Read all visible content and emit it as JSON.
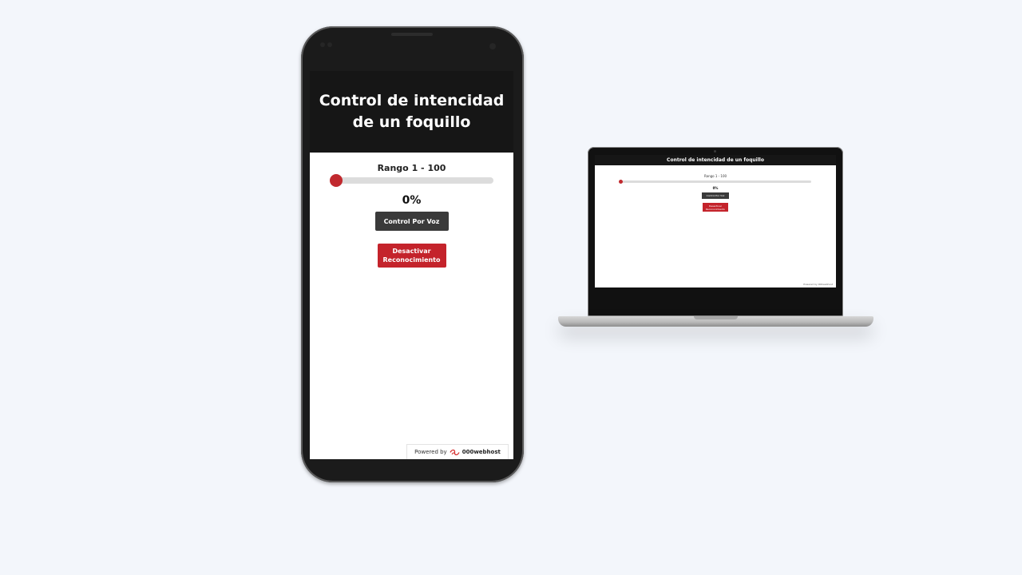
{
  "mobile": {
    "title": "Control de intencidad de un foquillo",
    "range_label": "Rango 1 - 100",
    "slider_value": 0,
    "percent_text": "0%",
    "voice_button_label": "Control Por Voz",
    "deactivate_button_label": "Desactivar\nReconocimiento",
    "powered_by_label": "Powered by",
    "powered_by_brand": "000webhost"
  },
  "laptop": {
    "title": "Control de intencidad de un foquillo",
    "range_label": "Rango 1 - 100",
    "slider_value": 0,
    "percent_text": "0%",
    "voice_button_label": "Control Por Voz",
    "deactivate_button_label": "Desactivar\nReconocimiento",
    "powered_by_text": "Powered by 000webhost"
  },
  "colors": {
    "page_background": "#f3f6fb",
    "header_background": "#161616",
    "accent_red": "#c4232b",
    "voice_button": "#3a3a3a"
  },
  "icons": {
    "powered_logo": "000webhost-logo-icon"
  }
}
